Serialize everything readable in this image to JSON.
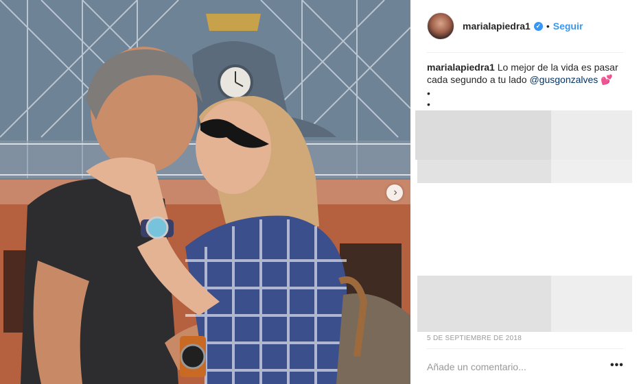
{
  "post": {
    "username": "marialapiedra1",
    "follow_label": "Seguir",
    "separator": "•",
    "verified_icon": "verified-badge-icon",
    "caption": {
      "username": "marialapiedra1",
      "text": "Lo mejor de la vida es pasar cada segundo a tu lado",
      "mention": "@gusgonzalves",
      "emoji": "💕",
      "bullets": [
        "•",
        "•"
      ]
    },
    "date": "5 DE SEPTIEMBRE DE 2018",
    "comment_placeholder": "Añade un comentario...",
    "more_label": "•••",
    "next_icon": "›"
  },
  "colors": {
    "link": "#3897f0",
    "mention": "#003569",
    "muted": "#999999"
  }
}
